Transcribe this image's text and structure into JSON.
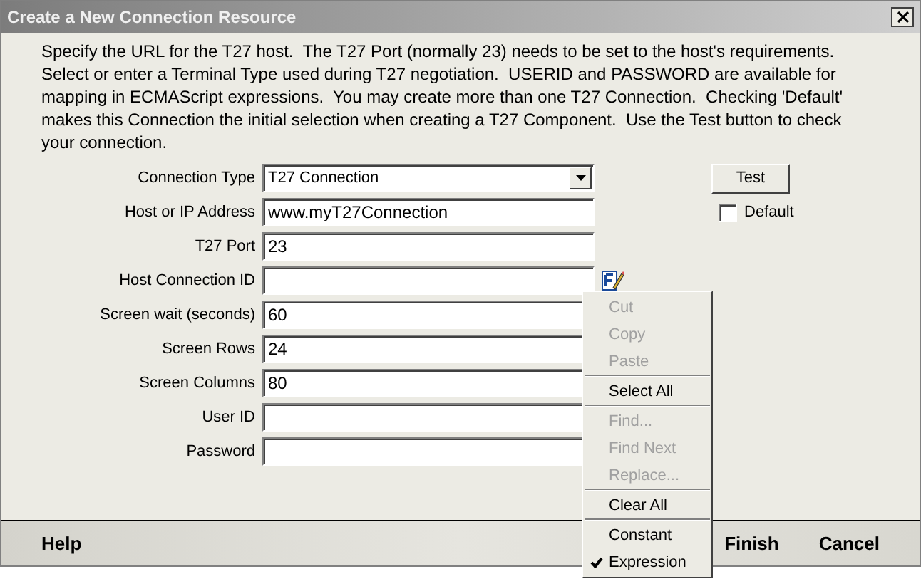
{
  "window": {
    "title": "Create a New Connection Resource"
  },
  "description": "Specify the URL for the T27 host.  The T27 Port (normally 23) needs to be set to the host's requirements.  Select or enter a Terminal Type used during T27 negotiation.  USERID and PASSWORD are available for mapping in ECMAScript expressions.  You may create more than one T27 Connection.  Checking 'Default' makes this Connection the initial selection when creating a T27 Component.  Use the Test button to check your connection.",
  "fields": [
    {
      "label": "Connection Type",
      "kind": "dropdown",
      "value": "T27 Connection"
    },
    {
      "label": "Host or IP Address",
      "kind": "text",
      "value": "www.myT27Connection"
    },
    {
      "label": "T27 Port",
      "kind": "text",
      "value": "23"
    },
    {
      "label": "Host Connection ID",
      "kind": "text",
      "expression_icon": true
    },
    {
      "label": "Screen wait (seconds)",
      "kind": "text",
      "value": "60"
    },
    {
      "label": "Screen Rows",
      "kind": "text",
      "value": "24"
    },
    {
      "label": "Screen Columns",
      "kind": "text",
      "value": "80"
    },
    {
      "label": "User ID",
      "kind": "text"
    },
    {
      "label": "Password",
      "kind": "text"
    }
  ],
  "test_button": "Test",
  "default_checkbox": {
    "label": "Default",
    "checked": false
  },
  "context_menu": [
    [
      {
        "label": "Cut",
        "disabled": true
      },
      {
        "label": "Copy",
        "disabled": true
      },
      {
        "label": "Paste",
        "disabled": true
      }
    ],
    [
      {
        "label": "Select All",
        "disabled": false
      }
    ],
    [
      {
        "label": "Find...",
        "disabled": true
      },
      {
        "label": "Find Next",
        "disabled": true
      },
      {
        "label": "Replace...",
        "disabled": true
      }
    ],
    [
      {
        "label": "Clear All",
        "disabled": false
      }
    ],
    [
      {
        "label": "Constant",
        "disabled": false,
        "checked": false
      },
      {
        "label": "Expression",
        "disabled": false,
        "checked": true
      }
    ]
  ],
  "footer": {
    "help": "Help",
    "buttons": [
      "Finish",
      "Cancel"
    ]
  }
}
